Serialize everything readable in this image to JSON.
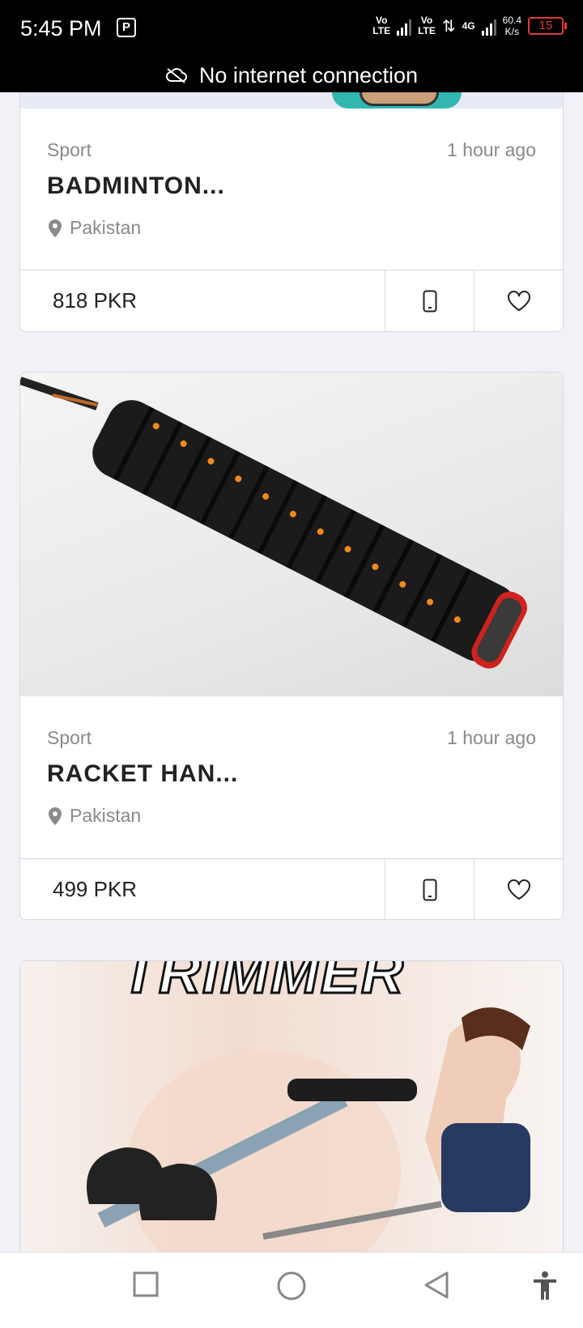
{
  "status_bar": {
    "time": "5:45 PM",
    "sim1_label_top": "Vo",
    "sim1_label_bottom": "LTE",
    "sim2_label_top": "Vo",
    "sim2_label_bottom": "LTE",
    "network_type": "4G",
    "speed_value": "60.4",
    "speed_unit": "K/s",
    "battery": "15"
  },
  "offline_banner": {
    "text": "No internet connection",
    "icon": "cloud-off-icon"
  },
  "listings": [
    {
      "category": "Sport",
      "time_ago": "1 hour ago",
      "title": "BADMINTON...",
      "location": "Pakistan",
      "price": "818 PKR"
    },
    {
      "category": "Sport",
      "time_ago": "1 hour ago",
      "title": "RACKET HAN...",
      "location": "Pakistan",
      "price": "499 PKR"
    },
    {
      "image_text": "TRIMMER"
    }
  ],
  "icons": {
    "call": "phone-icon",
    "favorite": "heart-icon",
    "location": "location-pin-icon"
  },
  "nav_bar": {
    "recents": "square-icon",
    "home": "circle-icon",
    "back": "triangle-back-icon",
    "accessibility": "accessibility-icon"
  },
  "colors": {
    "battery_low": "#e53935",
    "text_primary": "#222222",
    "text_secondary": "#8a8a8a",
    "background": "#f0f2f7"
  }
}
